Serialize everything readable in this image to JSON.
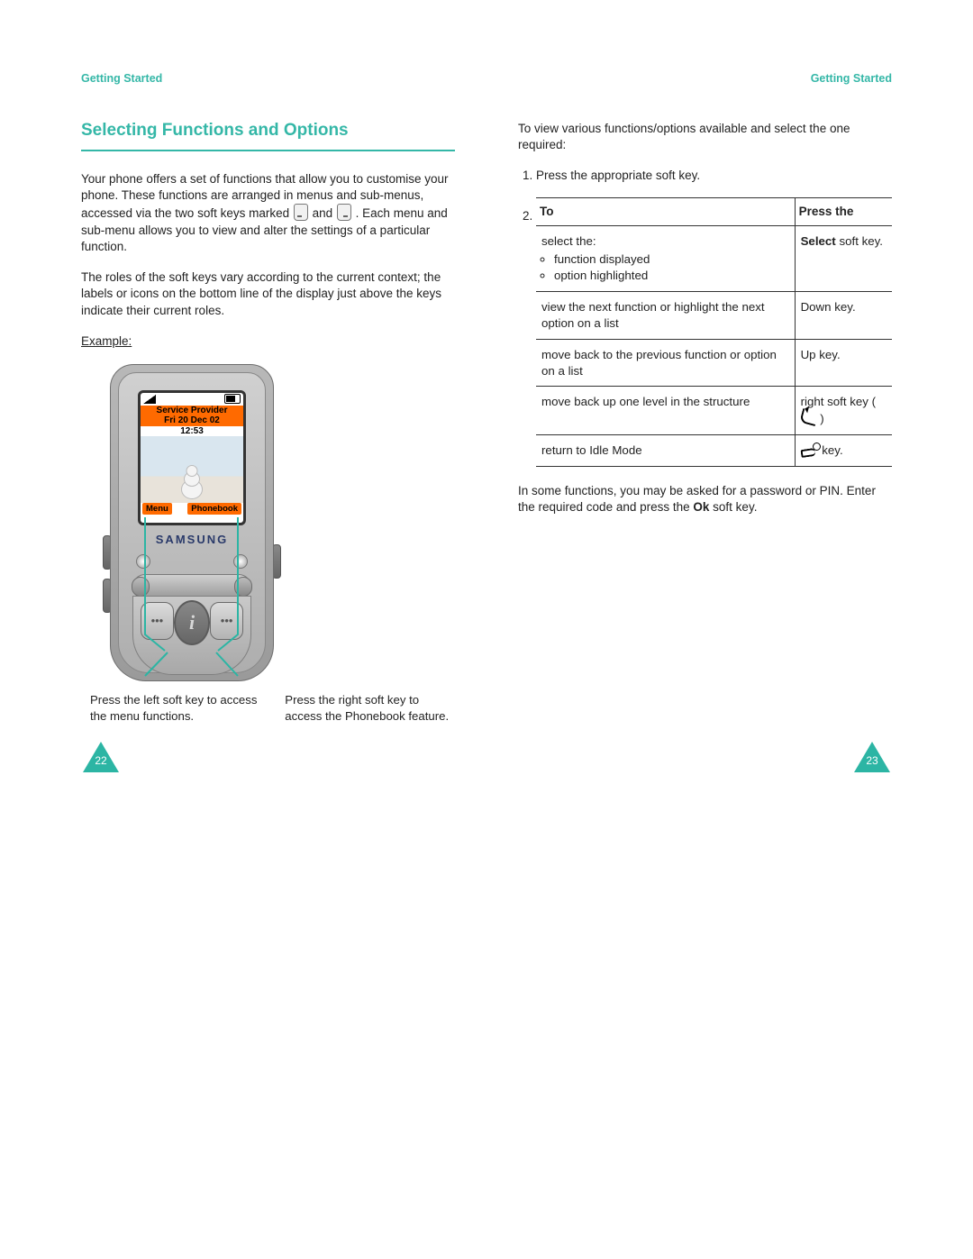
{
  "header": {
    "left": "Getting Started",
    "right": "Getting Started"
  },
  "left": {
    "title": "Selecting Functions and Options",
    "para1a": "Your phone offers a set of functions that allow you to customise your phone. These functions are arranged in menus and sub-menus, accessed via the two soft keys marked ",
    "para1b": " and ",
    "para1c": ". Each menu and sub-menu allows you to view and alter the settings of a particular function.",
    "para2": "The roles of the soft keys vary according to the current context; the labels or icons on the bottom line of the display just above the keys indicate their current roles.",
    "example": "Example:",
    "screen": {
      "provider": "Service Provider",
      "date": "Fri 20 Dec 02",
      "time": "12:53",
      "softLeft": "Menu",
      "softRight": "Phonebook",
      "brand": "SAMSUNG"
    },
    "captionLeft": "Press the left soft key to access the menu functions.",
    "captionRight": "Press the right soft key to access the Phonebook feature."
  },
  "right": {
    "intro": "To view various functions/options available and select the one required:",
    "step1": "Press the appropriate soft key.",
    "tbl_head_to": "To",
    "tbl_head_press": "Press the",
    "row1_to_a": "select the:",
    "row1_to_b": "function displayed",
    "row1_to_c": "option highlighted",
    "row1_press_bold": "Select",
    "row1_press_rest": " soft key.",
    "row2_to": "view the next function or highlight the next option on a list",
    "row2_press": "Down key.",
    "row3_to": "move back to the previous function or option on a list",
    "row3_press": "Up key.",
    "row4_to": "move back up one level in the structure",
    "row4_press_a": "right soft key ( ",
    "row4_press_b": " )",
    "row5_to": "return to Idle Mode",
    "row5_press": " key.",
    "outro_a": "In some functions, you may be asked for a password or PIN. Enter the required code and press the ",
    "outro_bold": "Ok",
    "outro_b": " soft key."
  },
  "pages": {
    "left": "22",
    "right": "23"
  }
}
